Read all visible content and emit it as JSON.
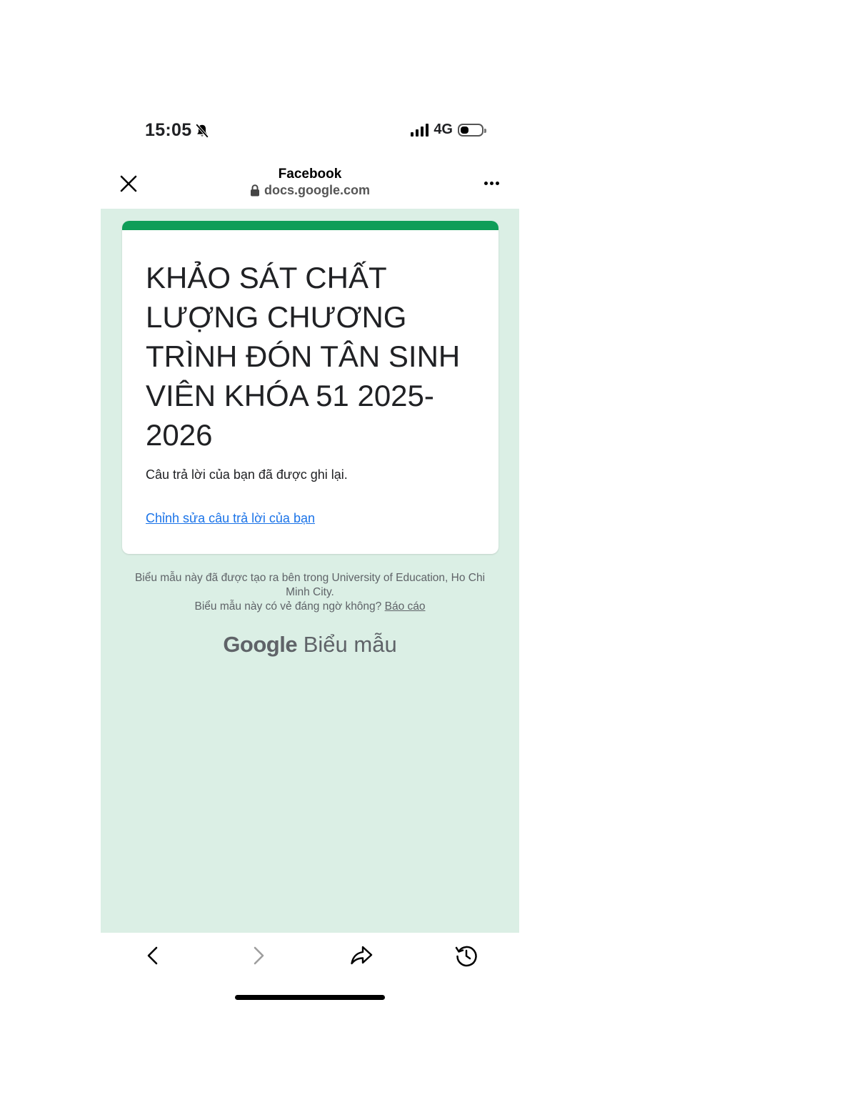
{
  "status_bar": {
    "time": "15:05",
    "network": "4G",
    "icons": [
      "bell-slash-icon",
      "signal-icon",
      "battery-icon"
    ],
    "battery_level": 0.4
  },
  "browser": {
    "title": "Facebook",
    "url": "docs.google.com",
    "icons": [
      "close-icon",
      "lock-icon",
      "more-icon"
    ]
  },
  "form": {
    "accent_color": "#0f9d58",
    "background_color": "#dbefe5",
    "title": "KHẢO SÁT CHẤT LƯỢNG CHƯƠNG TRÌNH ĐÓN TÂN SINH VIÊN KHÓA 51 2025-2026",
    "message": "Câu trả lời của bạn đã được ghi lại.",
    "edit_link": "Chỉnh sửa câu trả lời của bạn"
  },
  "footer": {
    "created_in": "Biểu mẫu này đã được tạo ra bên trong University of Education, Ho Chi Minh City.",
    "suspicious": "Biểu mẫu này có vẻ đáng ngờ không?",
    "report_link": "Báo cáo",
    "logo_google": "Google",
    "logo_product": "Biểu mẫu"
  },
  "bottom_nav": {
    "icons": [
      "back-icon",
      "forward-icon",
      "share-icon",
      "history-icon"
    ]
  }
}
